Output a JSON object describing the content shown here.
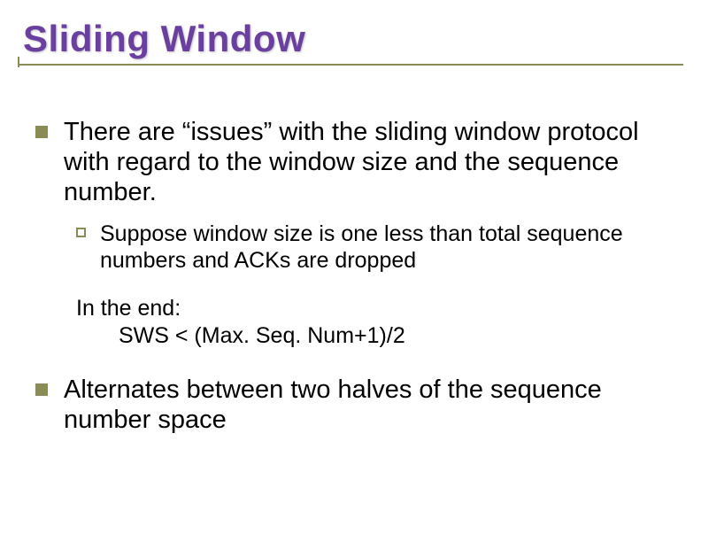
{
  "title": "Sliding Window",
  "bullets": {
    "main1": "There are “issues” with the sliding window protocol with regard to the window size and the sequence number.",
    "sub1": "Suppose window size is one less than total sequence numbers and ACKs are dropped",
    "conclusion_line1": "In the end:",
    "conclusion_line2": "SWS < (Max. Seq. Num+1)/2",
    "main2": "Alternates between two halves of the sequence number space"
  }
}
